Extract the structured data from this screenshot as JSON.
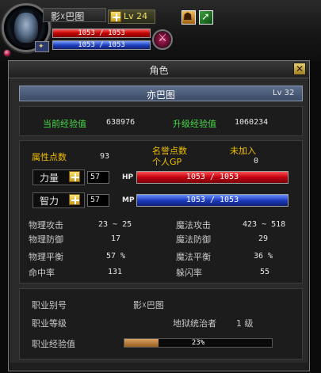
{
  "hud": {
    "name": "影☓巴图",
    "level": "Lv 24",
    "hp": "1053 / 1053",
    "mp": "1053 / 1053",
    "icons": [
      "portrait",
      "plus-icon",
      "pvp-icon",
      "buff-icon-1",
      "buff-icon-2",
      "party-icon"
    ]
  },
  "window": {
    "title": "角色",
    "close": "✕",
    "char_name": "亦巴图",
    "char_level": "Lv 32"
  },
  "exp": {
    "current_label": "当前经验值",
    "current_value": "638976",
    "next_label": "升级经验值",
    "next_value": "1060234"
  },
  "points": {
    "attr_label": "属性点数",
    "attr_value": "93",
    "fame_label": "名誉点数",
    "fame_value": "未加入",
    "gp_label": "个人GP",
    "gp_value": "0"
  },
  "base": {
    "str_label": "力量",
    "str_value": "57",
    "hp_label": "HP",
    "hp_value": "1053 / 1053",
    "int_label": "智力",
    "int_value": "57",
    "mp_label": "MP",
    "mp_value": "1053 / 1053"
  },
  "combat": {
    "left": [
      {
        "label": "物理攻击",
        "value": "23 ~ 25"
      },
      {
        "label": "物理防御",
        "value": "17"
      },
      {
        "label": "物理平衡",
        "value": "57 %"
      },
      {
        "label": "命中率",
        "value": "131"
      }
    ],
    "right": [
      {
        "label": "魔法攻击",
        "value": "423 ~ 518"
      },
      {
        "label": "魔法防御",
        "value": "29"
      },
      {
        "label": "魔法平衡",
        "value": "36 %"
      },
      {
        "label": "躲闪率",
        "value": "55"
      }
    ]
  },
  "job": {
    "alias_label": "职业别号",
    "alias_value": "影☓巴图",
    "level_label": "职业等级",
    "level_title": "地狱统治者",
    "level_value": "1 级",
    "exp_label": "职业经验值",
    "exp_text": "23%",
    "exp_fraction": 0.23
  },
  "colors": {
    "label": "#f0c000",
    "exp_green": "#48d848",
    "hp": "#c00010",
    "mp": "#1e3cc0",
    "namebar": "#4c5e7c"
  }
}
